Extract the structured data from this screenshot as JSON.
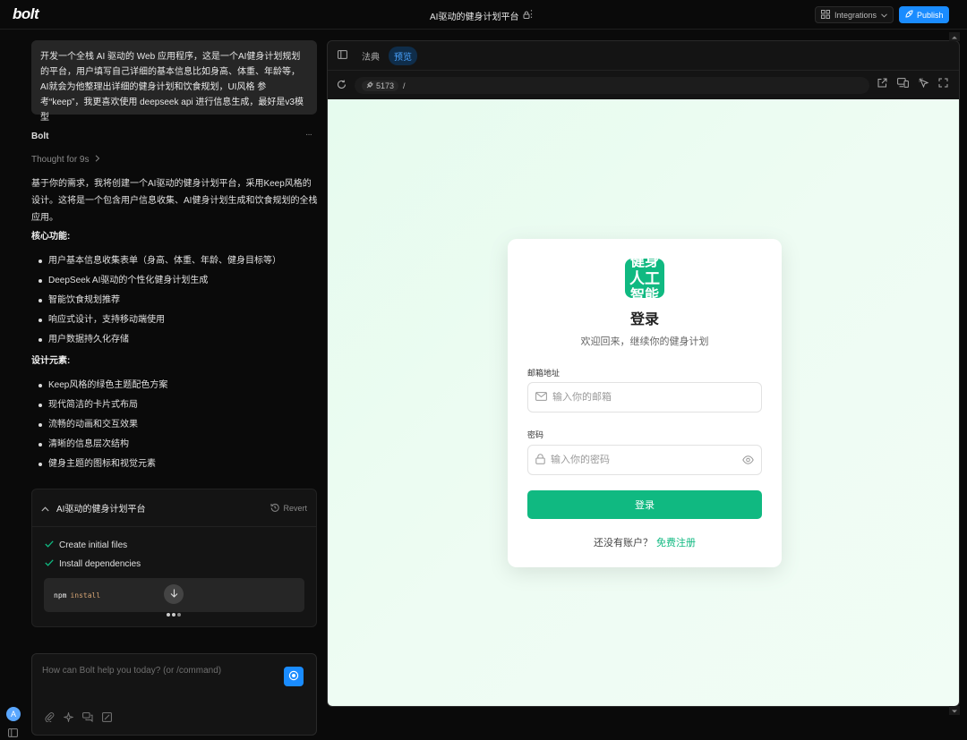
{
  "topbar": {
    "logo": "bolt",
    "project_title": "AI驱动的健身计划平台",
    "integrations_label": "Integrations",
    "publish_label": "Publish"
  },
  "chat": {
    "user_message": "开发一个全栈 AI 驱动的 Web 应用程序，这是一个AI健身计划规划的平台，用户填写自己详细的基本信息比如身高、体重、年龄等，AI就会为他整理出详细的健身计划和饮食规划，UI风格 参考“keep”，我更喜欢使用 deepseek api 进行信息生成，最好是v3模型",
    "assistant_name": "Bolt",
    "more": "···",
    "thought": "Thought for 9s",
    "intro": "基于你的需求，我将创建一个AI驱动的健身计划平台，采用Keep风格的设计。这将是一个包含用户信息收集、AI健身计划生成和饮食规划的全栈应用。",
    "section1_title": "核心功能:",
    "section1_items": [
      "用户基本信息收集表单（身高、体重、年龄、健身目标等）",
      "DeepSeek AI驱动的个性化健身计划生成",
      "智能饮食规划推荐",
      "响应式设计，支持移动端使用",
      "用户数据持久化存储"
    ],
    "section2_title": "设计元素:",
    "section2_items": [
      "Keep风格的绿色主题配色方案",
      "现代简洁的卡片式布局",
      "流畅的动画和交互效果",
      "清晰的信息层次结构",
      "健身主题的图标和视觉元素"
    ],
    "artifact": {
      "title": "AI驱动的健身计划平台",
      "revert_label": "Revert",
      "steps": [
        "Create initial files",
        "Install dependencies"
      ],
      "command_bin": "npm",
      "command_arg": "install"
    },
    "input_placeholder": "How can Bolt help you today? (or /command)",
    "avatar_initial": "A"
  },
  "preview": {
    "tabs": [
      "法典",
      "预览"
    ],
    "port": "5173",
    "path": "/",
    "login": {
      "icon_lines": [
        "健身",
        "人工",
        "智能"
      ],
      "title": "登录",
      "subtitle": "欢迎回来，继续你的健身计划",
      "email_label": "邮箱地址",
      "email_placeholder": "输入你的邮箱",
      "password_label": "密码",
      "password_placeholder": "输入你的密码",
      "submit_label": "登录",
      "signup_prompt": "还没有账户？",
      "signup_link": "免费注册"
    }
  },
  "colors": {
    "accent_blue": "#1a8cff",
    "brand_green": "#10b981"
  }
}
